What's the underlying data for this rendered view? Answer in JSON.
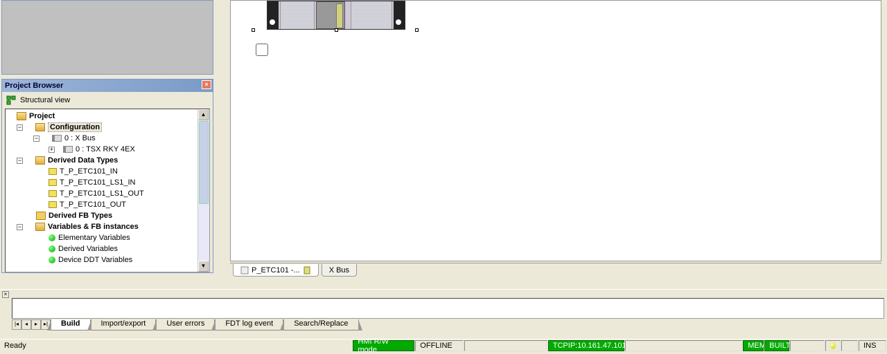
{
  "browser": {
    "title": "Project Browser",
    "view_label": "Structural view"
  },
  "tree": {
    "project": "Project",
    "configuration": "Configuration",
    "xbus": "0 : X Bus",
    "tsx": "0 : TSX RKY 4EX",
    "ddt": "Derived Data Types",
    "dt1": "T_P_ETC101_IN",
    "dt2": "T_P_ETC101_LS1_IN",
    "dt3": "T_P_ETC101_LS1_OUT",
    "dt4": "T_P_ETC101_OUT",
    "dfb": "Derived FB Types",
    "vfb": "Variables & FB instances",
    "v1": "Elementary Variables",
    "v2": "Derived Variables",
    "v3": "Device DDT Variables"
  },
  "doc_tabs": {
    "t1": "P_ETC101 -...",
    "t2": "X Bus"
  },
  "output_tabs": {
    "build": "Build",
    "impexp": "Import/export",
    "errors": "User errors",
    "fdt": "FDT log event",
    "search": "Search/Replace"
  },
  "status": {
    "ready": "Ready",
    "hmi": "HMI R/W mode",
    "offline": "OFFLINE",
    "tcpip": "TCPIP:10.161.47.101",
    "mem": "MEM",
    "built": "BUILT",
    "ins": "INS"
  }
}
